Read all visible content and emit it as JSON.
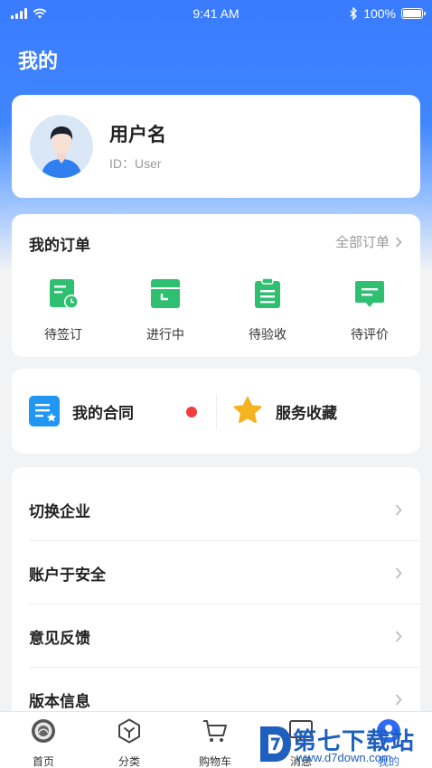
{
  "status_bar": {
    "time": "9:41 AM",
    "battery": "100%",
    "battery_level": 1.0
  },
  "page_title": "我的",
  "profile": {
    "username": "用户名",
    "user_id": "ID：User"
  },
  "orders": {
    "title": "我的订单",
    "all_label": "全部订单",
    "items": [
      {
        "label": "待签订",
        "icon": "contract-clock-icon"
      },
      {
        "label": "进行中",
        "icon": "box-icon"
      },
      {
        "label": "待验收",
        "icon": "clipboard-icon"
      },
      {
        "label": "待评价",
        "icon": "comment-icon"
      }
    ]
  },
  "shortcuts": {
    "contract": {
      "label": "我的合同",
      "icon": "contract-star-icon",
      "has_badge": true
    },
    "favorites": {
      "label": "服务收藏",
      "icon": "star-icon"
    }
  },
  "menu": [
    {
      "label": "切换企业"
    },
    {
      "label": "账户于安全"
    },
    {
      "label": "意见反馈"
    },
    {
      "label": "版本信息"
    }
  ],
  "tabs": [
    {
      "label": "首页",
      "icon": "home-icon"
    },
    {
      "label": "分类",
      "icon": "category-icon"
    },
    {
      "label": "购物车",
      "icon": "cart-icon"
    },
    {
      "label": "消息",
      "icon": "message-icon"
    },
    {
      "label": "我的",
      "icon": "profile-icon",
      "active": true
    }
  ],
  "watermark": {
    "text": "第七下载站",
    "url": "www.d7down.com"
  },
  "colors": {
    "primary": "#3a7bff",
    "green": "#2fbf71",
    "blue_icon": "#2196f3",
    "star": "#f5b320",
    "badge_red": "#f03e3e"
  }
}
